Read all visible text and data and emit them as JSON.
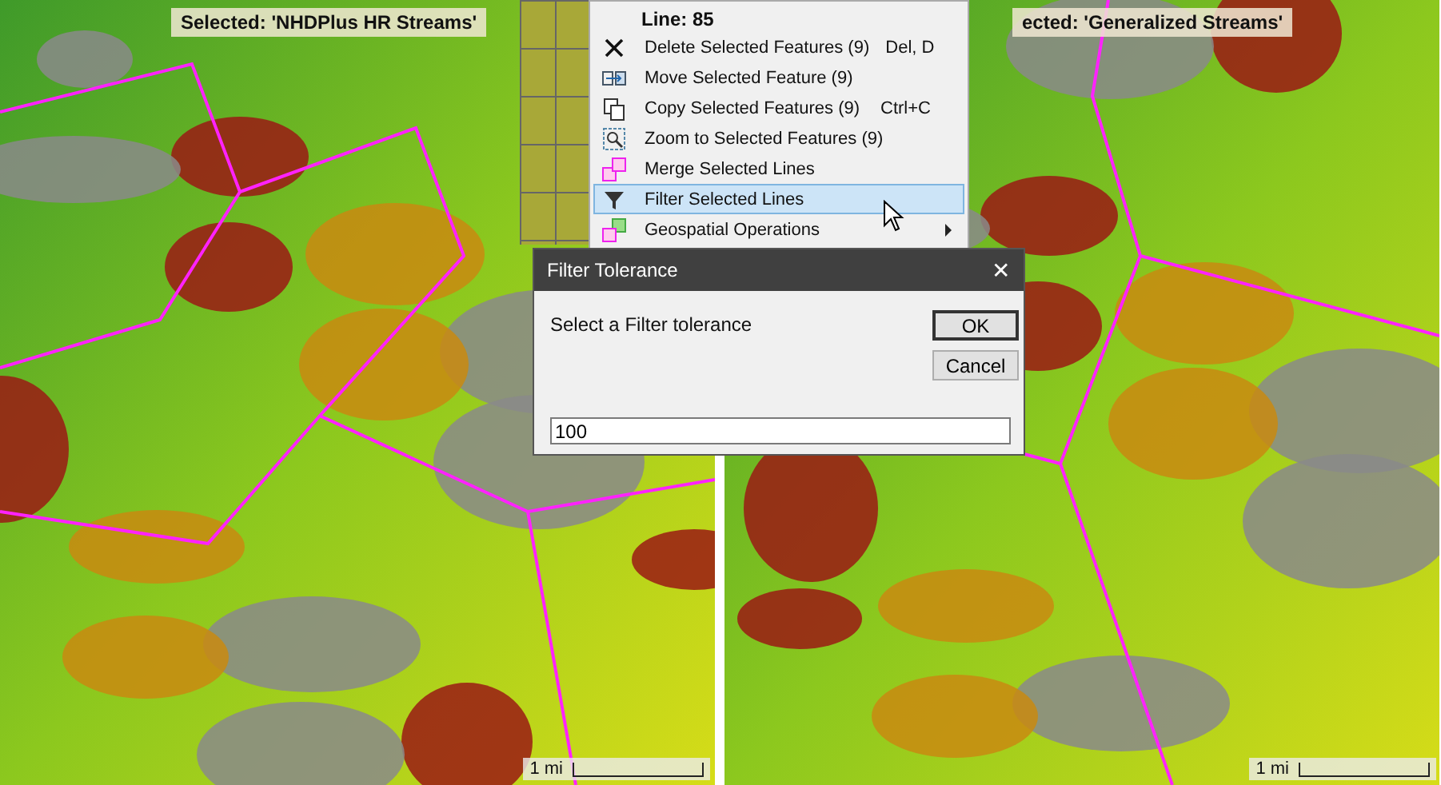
{
  "maps": [
    {
      "label": "Selected: 'NHDPlus HR Streams'",
      "scale": "1 mi"
    },
    {
      "label": "ected: 'Generalized Streams'",
      "scale": "1 mi"
    }
  ],
  "context_menu": {
    "title": "Line: 85",
    "items": [
      {
        "label": "Delete Selected Features (9)",
        "shortcut": "Del, D",
        "selected": false,
        "submenu": false
      },
      {
        "label": "Move Selected Feature (9)",
        "selected": false,
        "submenu": false
      },
      {
        "label": "Copy Selected Features (9)",
        "shortcut": "Ctrl+C",
        "selected": false,
        "submenu": false
      },
      {
        "label": "Zoom to Selected Features (9)",
        "selected": false,
        "submenu": false
      },
      {
        "label": "Merge Selected Lines",
        "selected": false,
        "submenu": false
      },
      {
        "label": "Filter Selected Lines",
        "selected": true,
        "submenu": false
      },
      {
        "label": "Geospatial Operations",
        "selected": false,
        "submenu": true
      }
    ]
  },
  "dialog": {
    "title": "Filter Tolerance",
    "close": "✕",
    "prompt": "Select a Filter tolerance",
    "value": "100",
    "buttons": [
      {
        "label": "OK",
        "default": true
      },
      {
        "label": "Cancel",
        "default": false
      }
    ]
  }
}
